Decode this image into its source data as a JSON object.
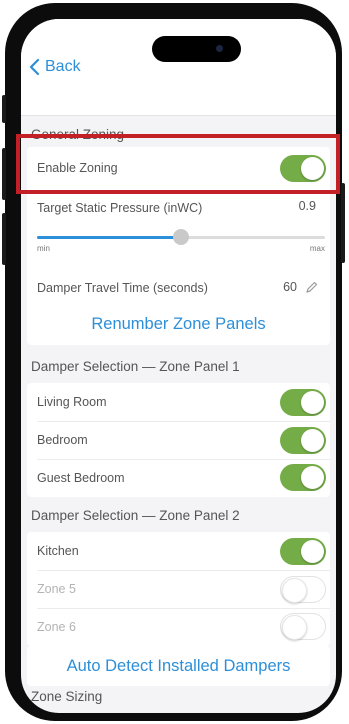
{
  "header": {
    "back_label": "Back"
  },
  "general_zoning": {
    "title": "General Zoning",
    "enable_zoning_label": "Enable Zoning",
    "enable_zoning_on": true,
    "static_pressure_label": "Target Static Pressure (inWC)",
    "static_pressure_value": "0.9",
    "static_pressure_level": 0.5,
    "slider_min_label": "min",
    "slider_max_label": "max",
    "damper_travel_label": "Damper Travel Time (seconds)",
    "damper_travel_value": "60",
    "renumber_label": "Renumber Zone Panels"
  },
  "zone_panel_1": {
    "title": "Damper Selection — Zone Panel 1",
    "items": [
      {
        "label": "Living Room",
        "on": true
      },
      {
        "label": "Bedroom",
        "on": true
      },
      {
        "label": "Guest Bedroom",
        "on": true
      }
    ]
  },
  "zone_panel_2": {
    "title": "Damper Selection — Zone Panel 2",
    "items": [
      {
        "label": "Kitchen",
        "on": true
      },
      {
        "label": "Zone 5",
        "on": false
      },
      {
        "label": "Zone 6",
        "on": false
      }
    ]
  },
  "auto_detect_label": "Auto Detect Installed Dampers",
  "zone_sizing_title": "Zone Sizing",
  "colors": {
    "accent_blue": "#2d8fd8",
    "toggle_on": "#74ad48",
    "highlight_red": "#c21f26"
  },
  "icons": [
    "chevron-left-icon",
    "pencil-icon"
  ]
}
